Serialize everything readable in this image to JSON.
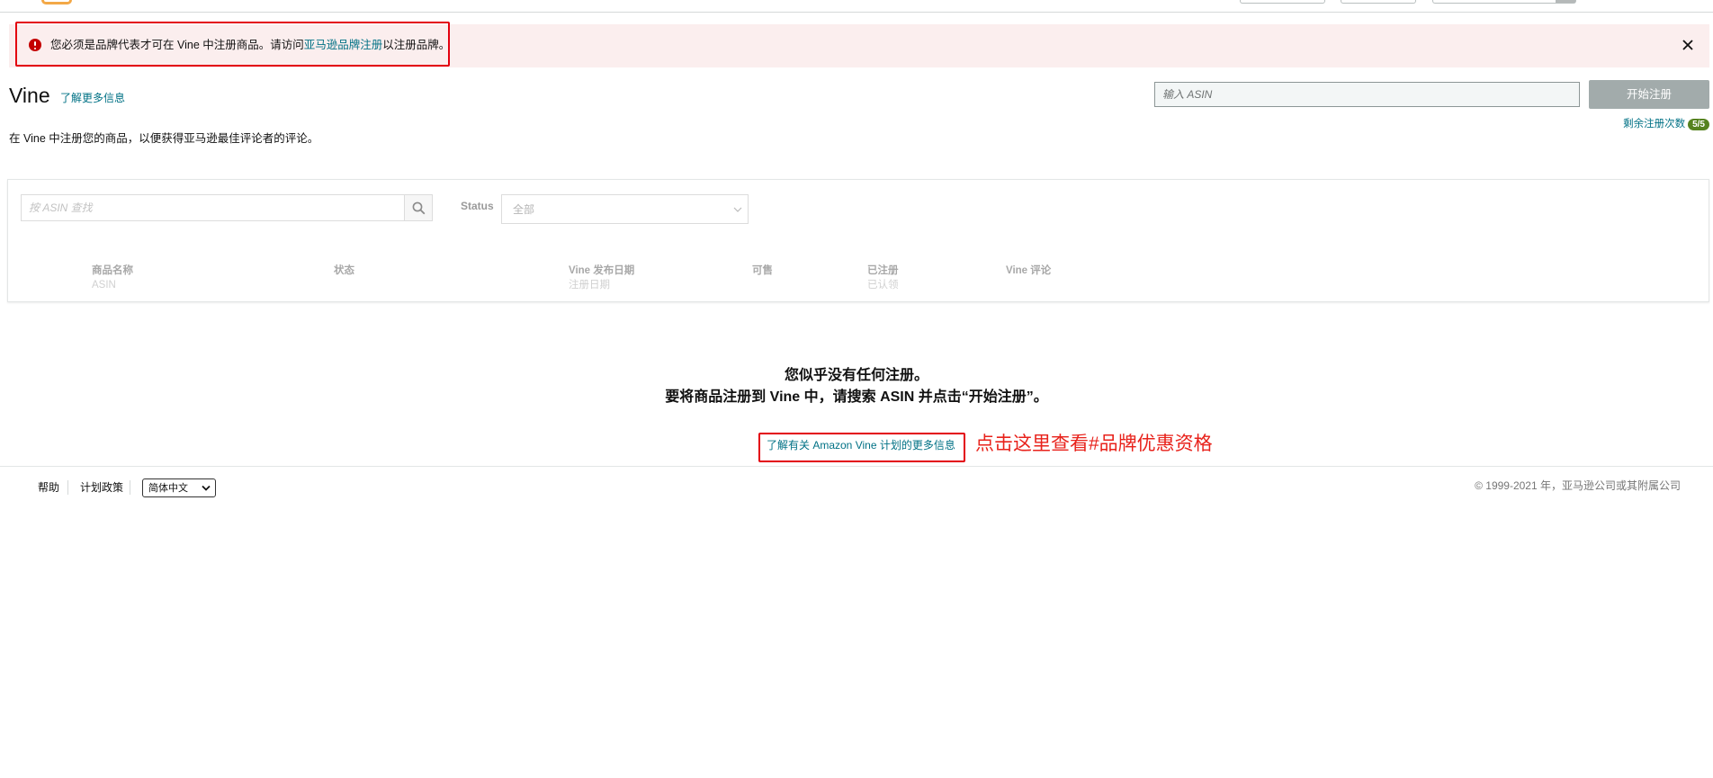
{
  "alert": {
    "text_before": "您必须是品牌代表才可在 Vine 中注册商品。请访问",
    "link": "亚马逊品牌注册",
    "text_after": "以注册品牌。"
  },
  "page": {
    "title": "Vine",
    "learn_more": "了解更多信息",
    "description": "在 Vine 中注册您的商品，以便获得亚马逊最佳评论者的评论。"
  },
  "enroll": {
    "asin_placeholder": "输入 ASIN",
    "button": "开始注册",
    "remaining_label": "剩余注册次数",
    "remaining_badge": "5/5"
  },
  "filters": {
    "search_placeholder": "按 ASIN 查找",
    "status_label": "Status",
    "status_value": "全部"
  },
  "table": {
    "columns": [
      {
        "title": "商品名称",
        "subtitle": "ASIN"
      },
      {
        "title": "状态",
        "subtitle": ""
      },
      {
        "title": "Vine 发布日期",
        "subtitle": "注册日期"
      },
      {
        "title": "可售",
        "subtitle": ""
      },
      {
        "title": "已注册",
        "subtitle": "已认领"
      },
      {
        "title": "Vine 评论",
        "subtitle": ""
      }
    ]
  },
  "empty": {
    "line1": "您似乎没有任何注册。",
    "line2": "要将商品注册到 Vine 中，请搜索 ASIN 并点击“开始注册”。",
    "link": "了解有关 Amazon Vine 计划的更多信息"
  },
  "annotation": "点击这里查看#品牌优惠资格",
  "footer": {
    "help": "帮助",
    "policy": "计划政策",
    "language": "简体中文",
    "copyright": "© 1999-2021 年，亚马逊公司或其附属公司"
  },
  "icons": {
    "alert": "error-icon",
    "close": "close-icon",
    "search": "search-icon",
    "dropdown": "chevron-down-icon"
  },
  "colors": {
    "link": "#007185",
    "alert_bg": "#fbeeee",
    "error": "#c40000",
    "annotation": "#e8221b",
    "button_bg": "#a2abab",
    "badge_bg": "#55821f"
  }
}
